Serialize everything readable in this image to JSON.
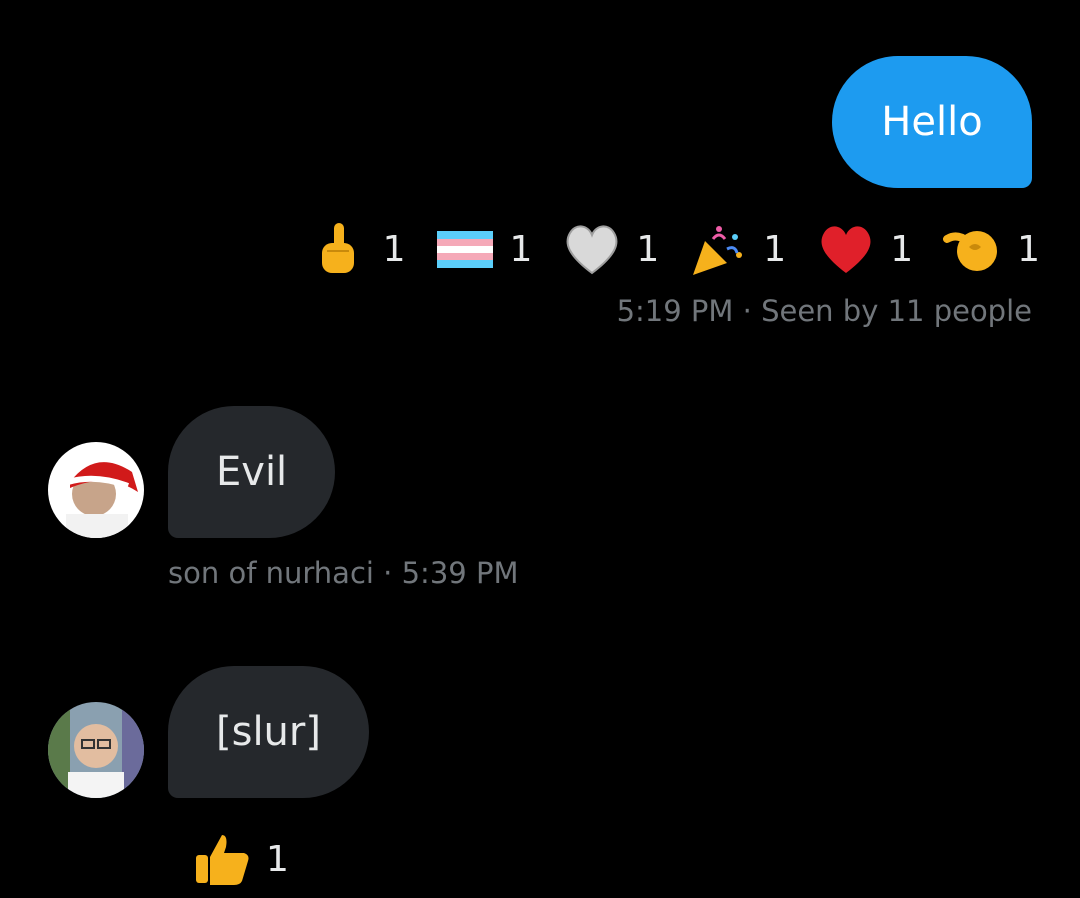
{
  "outgoing": {
    "text": "Hello",
    "reactions": [
      {
        "icon": "middle-finger-icon",
        "count": "1"
      },
      {
        "icon": "transgender-flag-icon",
        "count": "1"
      },
      {
        "icon": "white-heart-icon",
        "count": "1"
      },
      {
        "icon": "party-popper-icon",
        "count": "1"
      },
      {
        "icon": "red-heart-icon",
        "count": "1"
      },
      {
        "icon": "pinching-hand-icon",
        "count": "1"
      }
    ],
    "time": "5:19 PM",
    "separator": "·",
    "seen": "Seen by 11 people"
  },
  "incoming": [
    {
      "text": "Evil",
      "sender": "son of nurhaci",
      "separator": "·",
      "time": "5:39 PM",
      "avatar_icon": "avatar-santa-hat-icon"
    },
    {
      "text": "[slur]",
      "avatar_icon": "avatar-glasses-icon",
      "reactions": [
        {
          "icon": "thumbs-up-icon",
          "count": "1"
        }
      ]
    }
  ],
  "colors": {
    "background": "#000000",
    "outgoing_bubble": "#1d9bf0",
    "incoming_bubble": "#25282c",
    "meta_text": "#71767b"
  }
}
